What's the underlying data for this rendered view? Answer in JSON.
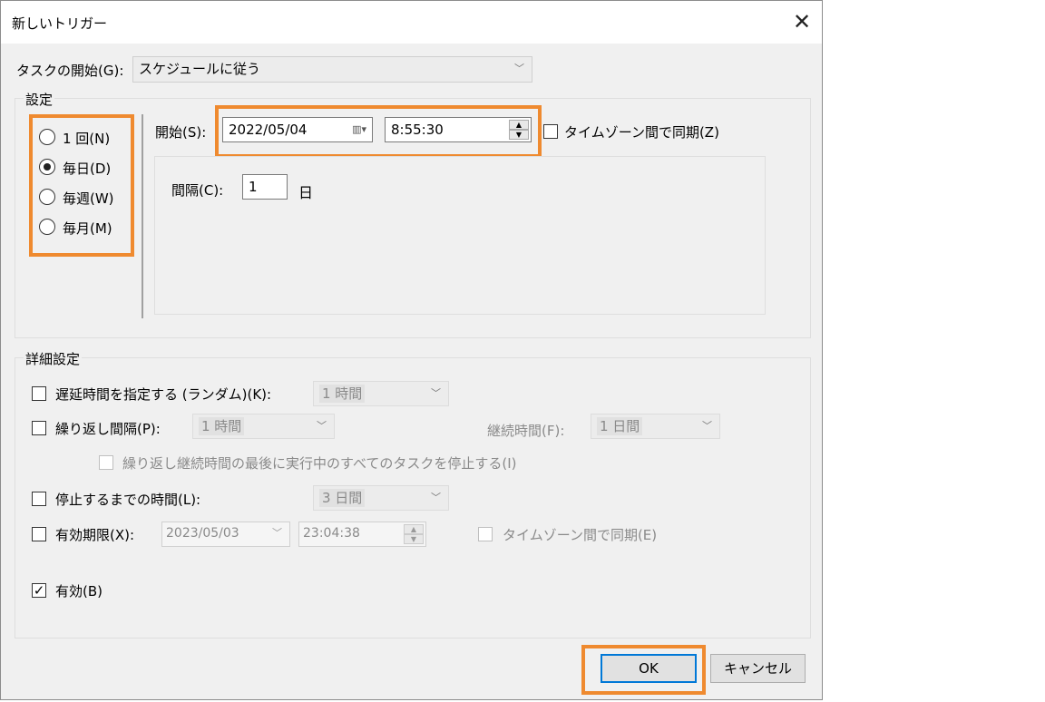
{
  "window": {
    "title": "新しいトリガー",
    "close_glyph": "✕"
  },
  "task_start": {
    "label": "タスクの開始(G):",
    "value": "スケジュールに従う"
  },
  "settings": {
    "group_title": "設定",
    "radios": [
      {
        "label": "1 回(N)",
        "checked": false
      },
      {
        "label": "毎日(D)",
        "checked": true
      },
      {
        "label": "毎週(W)",
        "checked": false
      },
      {
        "label": "毎月(M)",
        "checked": false
      }
    ],
    "start_label": "開始(S):",
    "start_date": "2022/05/04",
    "start_time": "8:55:30",
    "tz_sync_label": "タイムゾーン間で同期(Z)",
    "interval_label": "間隔(C):",
    "interval_value": "1",
    "interval_unit": "日"
  },
  "advanced": {
    "group_title": "詳細設定",
    "delay_label": "遅延時間を指定する (ランダム)(K):",
    "delay_value": "1 時間",
    "repeat_label": "繰り返し間隔(P):",
    "repeat_value": "1 時間",
    "duration_label": "継続時間(F):",
    "duration_value": "1 日間",
    "stop_running_label": "繰り返し継続時間の最後に実行中のすべてのタスクを停止する(I)",
    "stop_after_label": "停止するまでの時間(L):",
    "stop_after_value": "3 日間",
    "expire_label": "有効期限(X):",
    "expire_date": "2023/05/03",
    "expire_time": "23:04:38",
    "expire_tz_label": "タイムゾーン間で同期(E)",
    "enabled_label": "有効(B)",
    "enabled_checked": true
  },
  "buttons": {
    "ok": "OK",
    "cancel": "キャンセル"
  },
  "highlight_color": "#ef8a2f",
  "icons": {
    "calendar": "calendar-icon",
    "dropdown": "chevron-down-icon",
    "spinner": "spin-updown-icon",
    "checkmark": "✓"
  }
}
